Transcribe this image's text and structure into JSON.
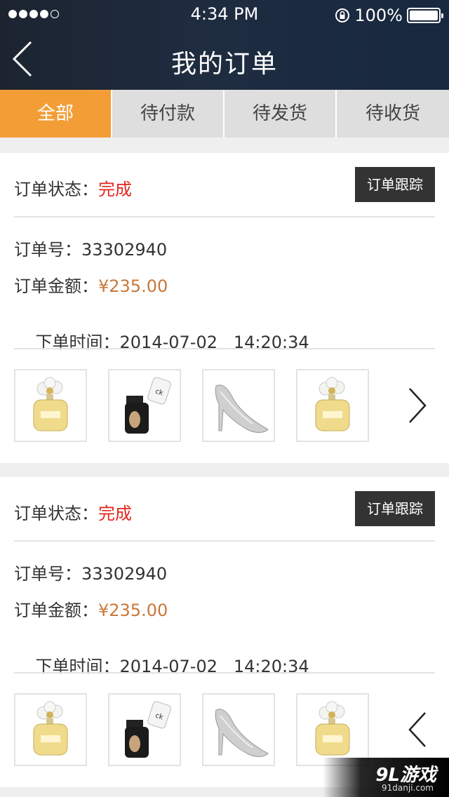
{
  "status_bar": {
    "time": "4:34 PM",
    "battery": "100%",
    "signal_dots": 5,
    "signal_filled": 4
  },
  "nav": {
    "title": "我的订单",
    "back_icon": "chevron-left-icon"
  },
  "tabs": [
    {
      "label": "全部",
      "active": true
    },
    {
      "label": "待付款",
      "active": false
    },
    {
      "label": "待发货",
      "active": false
    },
    {
      "label": "待收货",
      "active": false
    }
  ],
  "orders": [
    {
      "status_label": "订单状态：",
      "status_value": "完成",
      "track_button": "订单跟踪",
      "order_no_label": "订单号：",
      "order_no": "33302940",
      "amount_label": "订单金额：",
      "amount": "¥235.00",
      "time_label": "下单时间：",
      "time": "2014-07-02   14:20:34",
      "items": [
        "perfume-bottle",
        "cosmetic-bottle",
        "glitter-heel",
        "perfume-bottle"
      ],
      "arrow": "chevron-right-icon"
    },
    {
      "status_label": "订单状态：",
      "status_value": "完成",
      "track_button": "订单跟踪",
      "order_no_label": "订单号：",
      "order_no": "33302940",
      "amount_label": "订单金额：",
      "amount": "¥235.00",
      "time_label": "下单时间：",
      "time": "2014-07-02   14:20:34",
      "items": [
        "perfume-bottle",
        "cosmetic-bottle",
        "glitter-heel",
        "perfume-bottle"
      ],
      "arrow": "chevron-left-icon"
    }
  ],
  "colors": {
    "accent": "#f39d36",
    "status": "#e3261c",
    "price": "#c8783a",
    "header": "#1f2c40"
  },
  "watermark": {
    "main": "9L游戏",
    "sub": "91danji.com"
  }
}
